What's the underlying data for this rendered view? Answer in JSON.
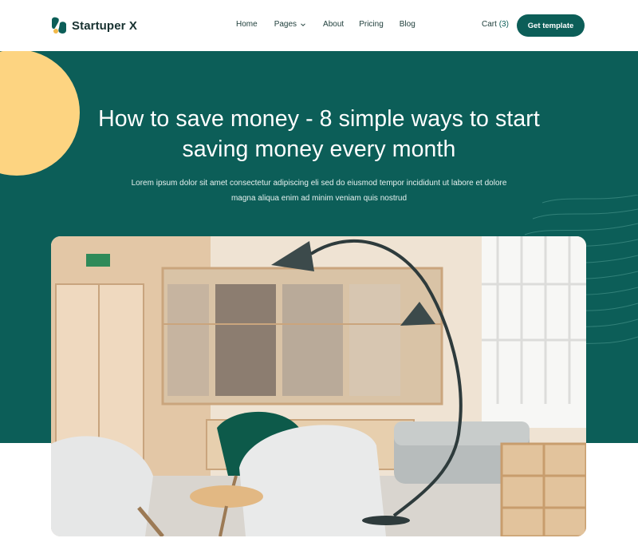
{
  "brand": {
    "name": "Startuper X",
    "logo_icon": "leaf-logo-icon"
  },
  "nav": {
    "items": [
      {
        "label": "Home"
      },
      {
        "label": "Pages",
        "has_dropdown": true
      },
      {
        "label": "About"
      },
      {
        "label": "Pricing"
      },
      {
        "label": "Blog"
      }
    ]
  },
  "cart": {
    "label": "Cart",
    "count": "(3)"
  },
  "cta": {
    "label": "Get template"
  },
  "hero": {
    "title": "How to save money - 8 simple ways to start saving money every month",
    "subtitle": "Lorem ipsum dolor sit amet consectetur adipiscing eli sed do eiusmod tempor incididunt ut labore et dolore magna aliqua enim ad minim veniam quis nostrud"
  },
  "photo": {
    "subject": "office lounge with chairs, lamp and sofa"
  },
  "colors": {
    "primary": "#0c5e58",
    "accent_yellow": "#fdd481",
    "text_dark": "#173130",
    "white": "#ffffff"
  }
}
